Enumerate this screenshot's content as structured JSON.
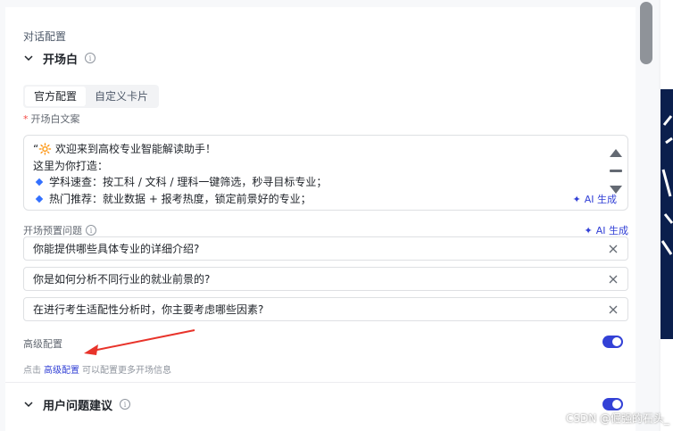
{
  "section_title": "对话配置",
  "opening": {
    "label": "开场白",
    "tabs": [
      "官方配置",
      "自定义卡片"
    ],
    "text_label": "开场白文案",
    "text_lines": [
      "“🔆 欢迎来到高校专业智能解读助手！",
      "这里为你打造："
    ],
    "bullets": [
      "学科速查：按工科 / 文科 / 理科一键筛选，秒寻目标专业；",
      "热门推荐：就业数据 + 报考热度，锁定前景好的专业；"
    ],
    "ai_label": "AI 生成"
  },
  "preset": {
    "label": "开场预置问题",
    "ai_label": "AI 生成",
    "questions": [
      "你能提供哪些具体专业的详细介绍?",
      "你是如何分析不同行业的就业前景的?",
      "在进行考生适配性分析时，你主要考虑哪些因素?"
    ]
  },
  "advanced": {
    "label": "高级配置",
    "hint_prefix": "点击",
    "hint_link": "高级配置",
    "hint_suffix": "可以配置更多开场信息",
    "enabled": true
  },
  "suggestions": {
    "label": "用户问题建议",
    "enabled": true
  },
  "watermark": "CSDN @倔强的石头_",
  "colors": {
    "accent": "#3341d6",
    "arrow": "#e8332a"
  }
}
